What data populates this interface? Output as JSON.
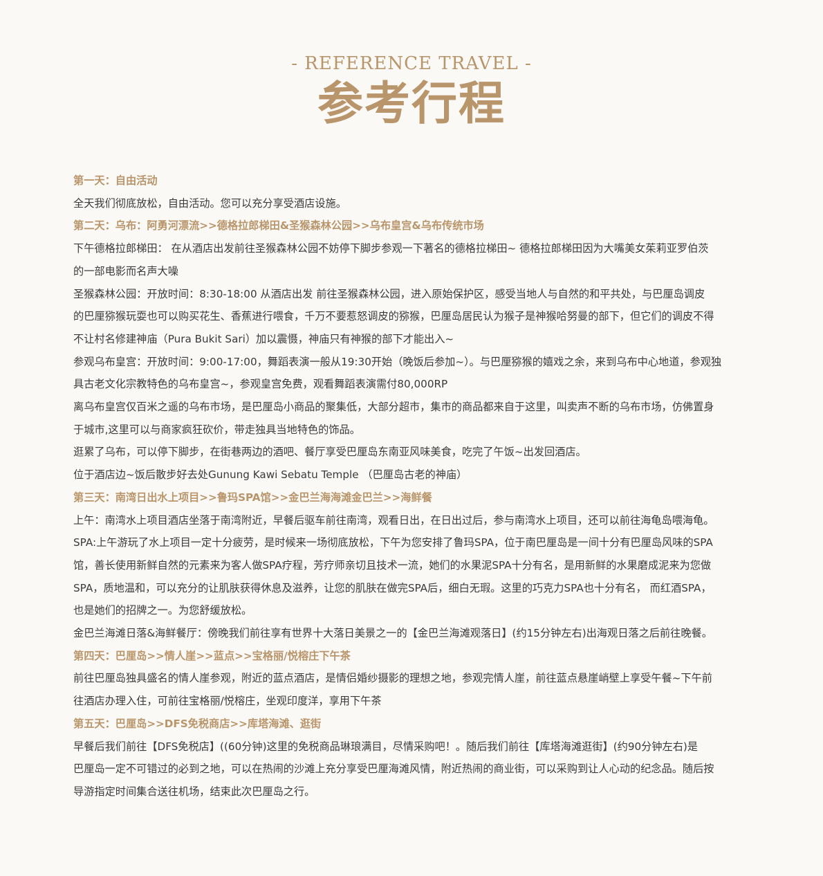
{
  "header": {
    "subtitle": "- REFERENCE TRAVEL -",
    "title": "参考行程"
  },
  "lines": [
    {
      "type": "day",
      "text": "第一天：自由活动"
    },
    {
      "type": "text",
      "text": "全天我们彻底放松，自由活动。您可以充分享受酒店设施。"
    },
    {
      "type": "day",
      "text": "第二天：乌布：阿勇河漂流>>德格拉郎梯田&圣猴森林公园>>乌布皇宫&乌布传统市场"
    },
    {
      "type": "text",
      "text": "下午德格拉郎梯田： 在从酒店出发前往圣猴森林公园不妨停下脚步参观一下著名的德格拉梯田~  德格拉郎梯田因为大嘴美女茱莉亚罗伯茨"
    },
    {
      "type": "text",
      "text": "的一部电影而名声大噪"
    },
    {
      "type": "text",
      "text": "圣猴森林公园：开放时间：8:30-18:00   从酒店出发  前往圣猴森林公园，进入原始保护区，感受当地人与自然的和平共处，与巴厘岛调皮"
    },
    {
      "type": "text",
      "text": "的巴厘猕猴玩耍也可以购买花生、香蕉进行喂食，千万不要惹怒调皮的猕猴，巴厘岛居民认为猴子是神猴哈努曼的部下，但它们的调皮不得"
    },
    {
      "type": "text",
      "text": "不让村名修建神庙（Pura Bukit Sari）加以震慑，神庙只有神猴的部下才能出入~"
    },
    {
      "type": "text",
      "text": "参观乌布皇宫：开放时间：9:00-17:00，舞蹈表演一般从19:30开始（晚饭后参加~）。与巴厘猕猴的嬉戏之余，来到乌布中心地道，参观独"
    },
    {
      "type": "text",
      "text": "具古老文化宗教特色的乌布皇宫~，参观皇宫免费，观看舞蹈表演需付80,000RP"
    },
    {
      "type": "text",
      "text": "离乌布皇宫仅百米之遥的乌布市场，是巴厘岛小商品的聚集低，大部分超市，集市的商品都来自于这里，叫卖声不断的乌布市场，仿佛置身"
    },
    {
      "type": "text",
      "text": "于城市,这里可以与商家疯狂砍价，带走独具当地特色的饰品。"
    },
    {
      "type": "text",
      "text": "逛累了乌布，可以停下脚步，在街巷两边的酒吧、餐厅享受巴厘岛东南亚风味美食，吃完了午饭~出发回酒店。"
    },
    {
      "type": "text",
      "text": "位于酒店边~饭后散步好去处Gunung Kawi Sebatu Temple  （巴厘岛古老的神庙）"
    },
    {
      "type": "day",
      "text": "第三天：南湾日出水上项目>>鲁玛SPA馆>>金巴兰海海滩金巴兰>>海鲜餐"
    },
    {
      "type": "text",
      "text": "上午：南湾水上项目酒店坐落于南湾附近，早餐后驱车前往南湾，观看日出，在日出过后，参与南湾水上项目，还可以前往海龟岛喂海龟。"
    },
    {
      "type": "text",
      "text": "SPA:上午游玩了水上项目一定十分疲劳，是时候来一场彻底放松，下午为您安排了鲁玛SPA，位于南巴厘岛是一间十分有巴厘岛风味的SPA"
    },
    {
      "type": "text",
      "text": "馆，善长使用新鲜自然的元素来为客人做SPA疗程，芳疗师亲切且技术一流，她们的水果泥SPA十分有名，是用新鲜的水果磨成泥来为您做"
    },
    {
      "type": "text",
      "text": "SPA，质地温和，可以充分的让肌肤获得休息及滋养，让您的肌肤在做完SPA后，细白无瑕。这里的巧克力SPA也十分有名， 而红酒SPA，"
    },
    {
      "type": "text",
      "text": "也是她们的招牌之一。为您舒缓放松。"
    },
    {
      "type": "text",
      "text": "金巴兰海滩日落&海鲜餐厅：傍晚我们前往享有世界十大落日美景之一的【金巴兰海滩观落日】(约15分钟左右)出海观日落之后前往晚餐。"
    },
    {
      "type": "day",
      "text": "第四天：巴厘岛>>情人崖>>蓝点>>宝格丽/悦榕庄下午茶"
    },
    {
      "type": "text",
      "text": "前往巴厘岛独具盛名的情人崖参观，附近的蓝点酒店，是情侣婚纱摄影的理想之地，参观完情人崖，前往蓝点悬崖峭壁上享受午餐~下午前"
    },
    {
      "type": "text",
      "text": "往酒店办理入住，可前往宝格丽/悦榕庄，坐观印度洋，享用下午茶"
    },
    {
      "type": "day",
      "text": "第五天：巴厘岛>>DFS免税商店>>库塔海滩、逛街"
    },
    {
      "type": "text",
      "text": "早餐后我们前往【DFS免税店】((60分钟)这里的免税商品琳琅满目，尽情采购吧！。随后我们前往【库塔海滩逛街】(约90分钟左右)是"
    },
    {
      "type": "text",
      "text": "巴厘岛一定不可错过的必到之地，可以在热闹的沙滩上充分享受巴厘海滩风情，附近热闹的商业街，可以采购到让人心动的纪念品。随后按"
    },
    {
      "type": "text",
      "text": "导游指定时间集合送往机场，结束此次巴厘岛之行。"
    }
  ]
}
